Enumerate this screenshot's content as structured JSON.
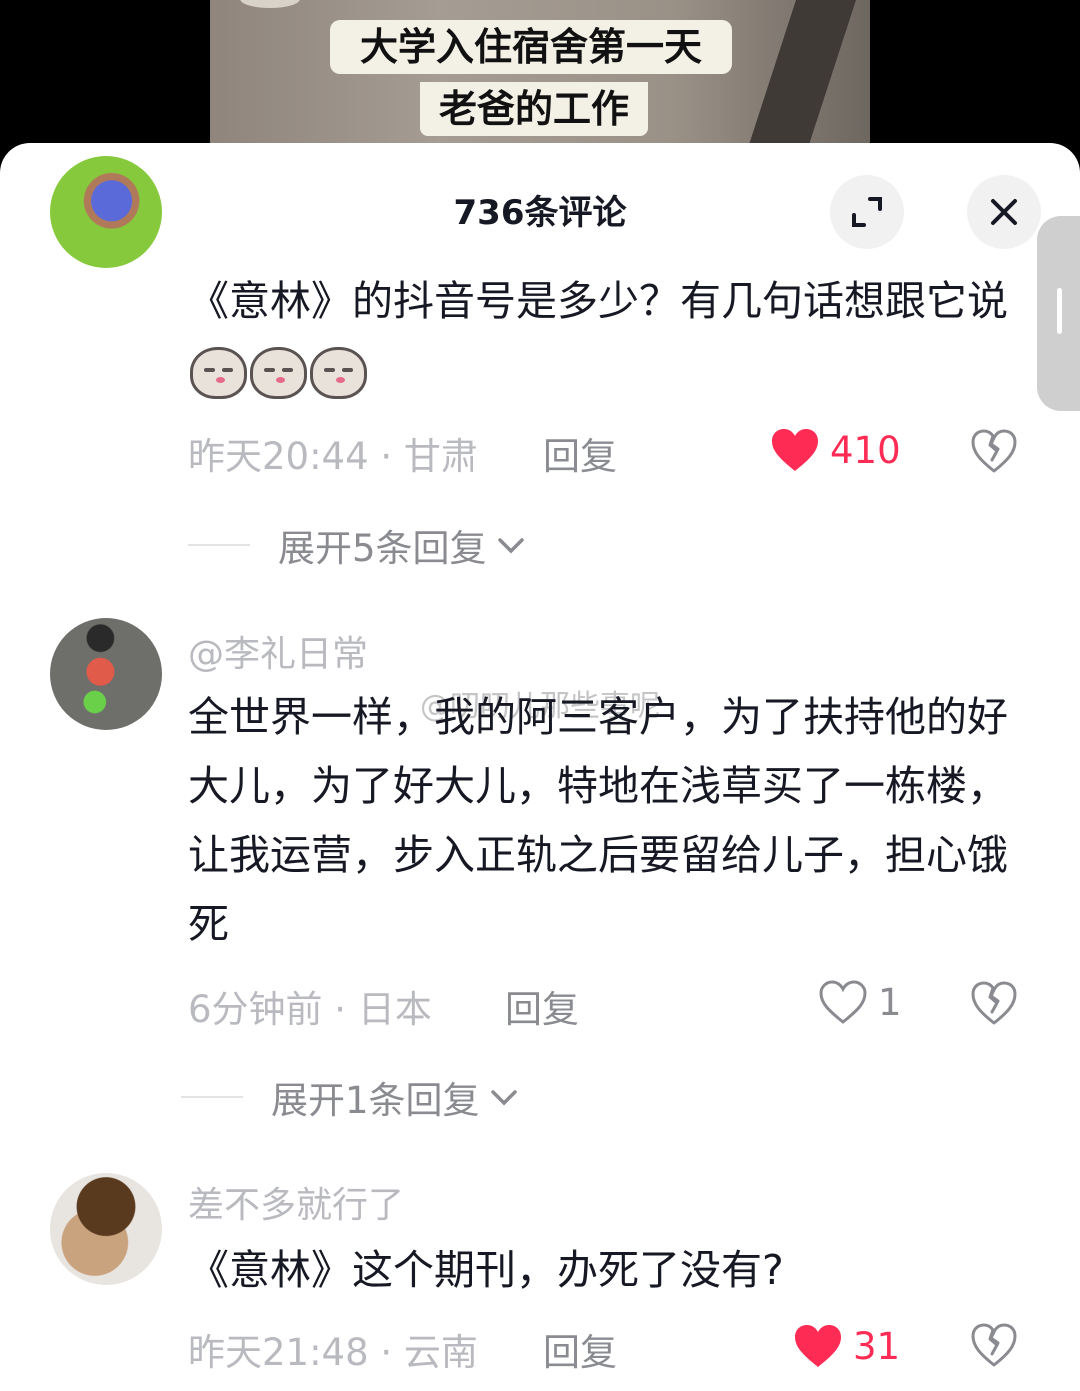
{
  "video": {
    "caption_line1": "大学入住宿舍第一天",
    "caption_line2": "老爸的工作"
  },
  "header": {
    "title": "736条评论",
    "expand_icon": "expand-icon",
    "close_icon": "close-icon"
  },
  "colors": {
    "like_red": "#fe2c55",
    "muted": "#8a8b91",
    "text": "#161823"
  },
  "watermark": "@叨叨儿那些事呢",
  "comments": [
    {
      "username": "",
      "text": "《意林》的抖音号是多少？有几句话想跟它说",
      "emoji_count": 3,
      "meta": "昨天20:44 · 甘肃",
      "reply": "回复",
      "likes": "410",
      "liked": true,
      "expand": "展开5条回复"
    },
    {
      "username": "@李礼日常",
      "text": "全世界一样，我的阿三客户，为了扶持他的好大儿，为了好大儿，特地在浅草买了一栋楼，让我运营，步入正轨之后要留给儿子，担心饿死",
      "meta": "6分钟前 · 日本",
      "reply": "回复",
      "likes": "1",
      "liked": false,
      "expand": "展开1条回复"
    },
    {
      "username": "差不多就行了",
      "text": "《意林》这个期刊，办死了没有?",
      "meta": "昨天21:48 · 云南",
      "reply": "回复",
      "likes": "31",
      "liked": true
    }
  ]
}
